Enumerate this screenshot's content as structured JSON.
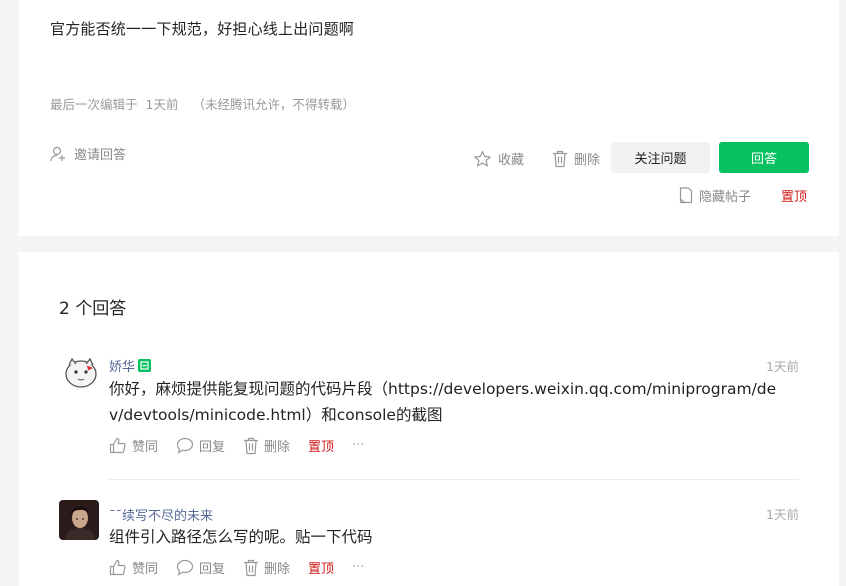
{
  "question": {
    "text": "官方能否统一一下规范，好担心线上出问题啊",
    "edit_prefix": "最后一次编辑于",
    "edit_time": "1天前",
    "edit_notice": "（未经腾讯允许，不得转载）",
    "invite_label": "邀请回答",
    "collect_label": "收藏",
    "delete_label": "删除",
    "follow_label": "关注问题",
    "answer_label": "回答",
    "hide_label": "隐藏帖子",
    "pin_label": "置顶"
  },
  "answers_section": {
    "count_text": "2 个回答",
    "answers": [
      {
        "user": "娇华",
        "time": "1天前",
        "text_line1": "你好，麻烦提供能复现问题的代码片段（https://developers.weixin.qq.com/miniprogram/de",
        "text_line2": "v/devtools/minicode.html）和console的截图",
        "like_label": "赞同",
        "reply_label": "回复",
        "delete_label": "删除",
        "pin_label": "置顶",
        "more_label": "···"
      },
      {
        "user": "ˉˉ续写不尽的未来",
        "time": "1天前",
        "text_line1": "组件引入路径怎么写的呢。贴一下代码",
        "like_label": "赞同",
        "reply_label": "回复",
        "delete_label": "删除",
        "pin_label": "置顶",
        "more_label": "···"
      }
    ]
  },
  "colors": {
    "accent_green": "#07c160",
    "link_blue": "#576b95",
    "pin_red": "#d01a1a"
  },
  "icons": [
    "invite-icon",
    "star-icon",
    "trash-icon",
    "document-icon",
    "official-badge-icon",
    "thumb-up-icon",
    "comment-icon"
  ]
}
